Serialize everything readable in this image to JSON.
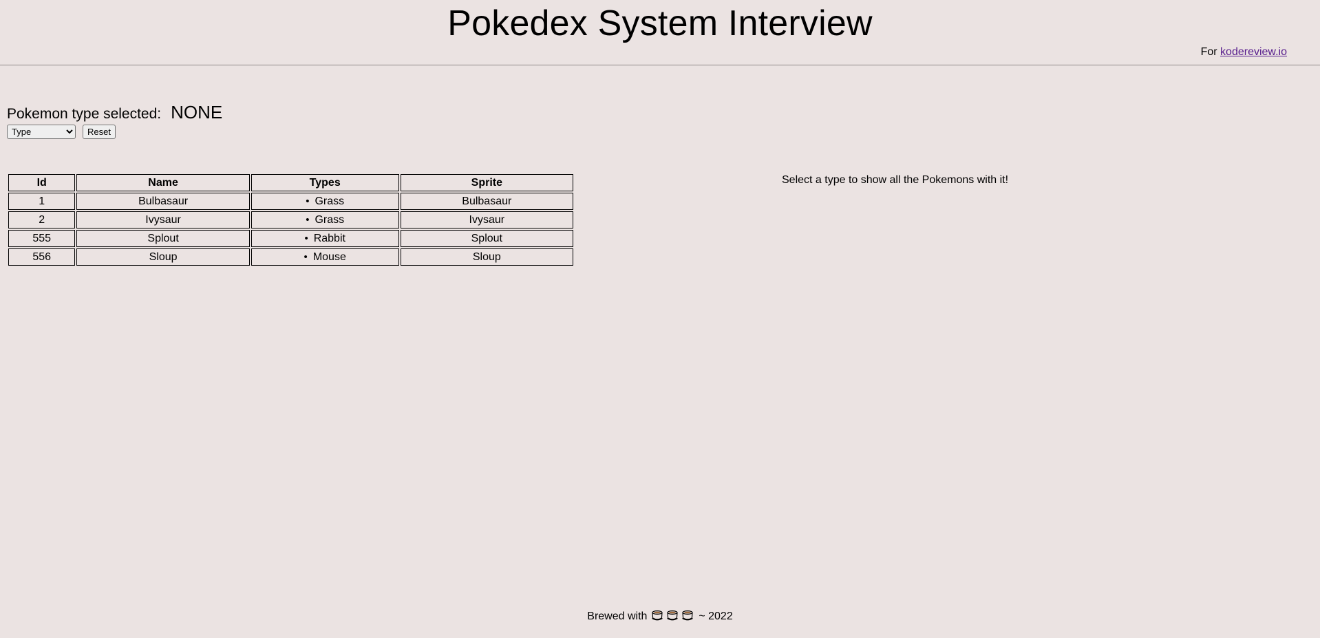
{
  "header": {
    "title": "Pokedex System Interview",
    "for_prefix": "For",
    "for_link": "kodereview.io"
  },
  "controls": {
    "selected_label": "Pokemon type selected:",
    "selected_value": "NONE",
    "type_select_value": "Type",
    "reset_label": "Reset"
  },
  "table": {
    "headers": [
      "Id",
      "Name",
      "Types",
      "Sprite"
    ],
    "rows": [
      {
        "id": "1",
        "name": "Bulbasaur",
        "type": "Grass",
        "sprite": "Bulbasaur"
      },
      {
        "id": "2",
        "name": "Ivysaur",
        "type": "Grass",
        "sprite": "Ivysaur"
      },
      {
        "id": "555",
        "name": "Splout",
        "type": "Rabbit",
        "sprite": "Splout"
      },
      {
        "id": "556",
        "name": "Sloup",
        "type": "Mouse",
        "sprite": "Sloup"
      }
    ]
  },
  "hint": "Select a type to show all the Pokemons with it!",
  "footer": {
    "prefix": "Brewed with",
    "icons": [
      "mug-icon",
      "mug-icon",
      "mug-icon"
    ],
    "suffix": "~ 2022"
  },
  "colors": {
    "background": "#ebe3e2",
    "link": "#551a8b",
    "divider": "#8e8888"
  }
}
